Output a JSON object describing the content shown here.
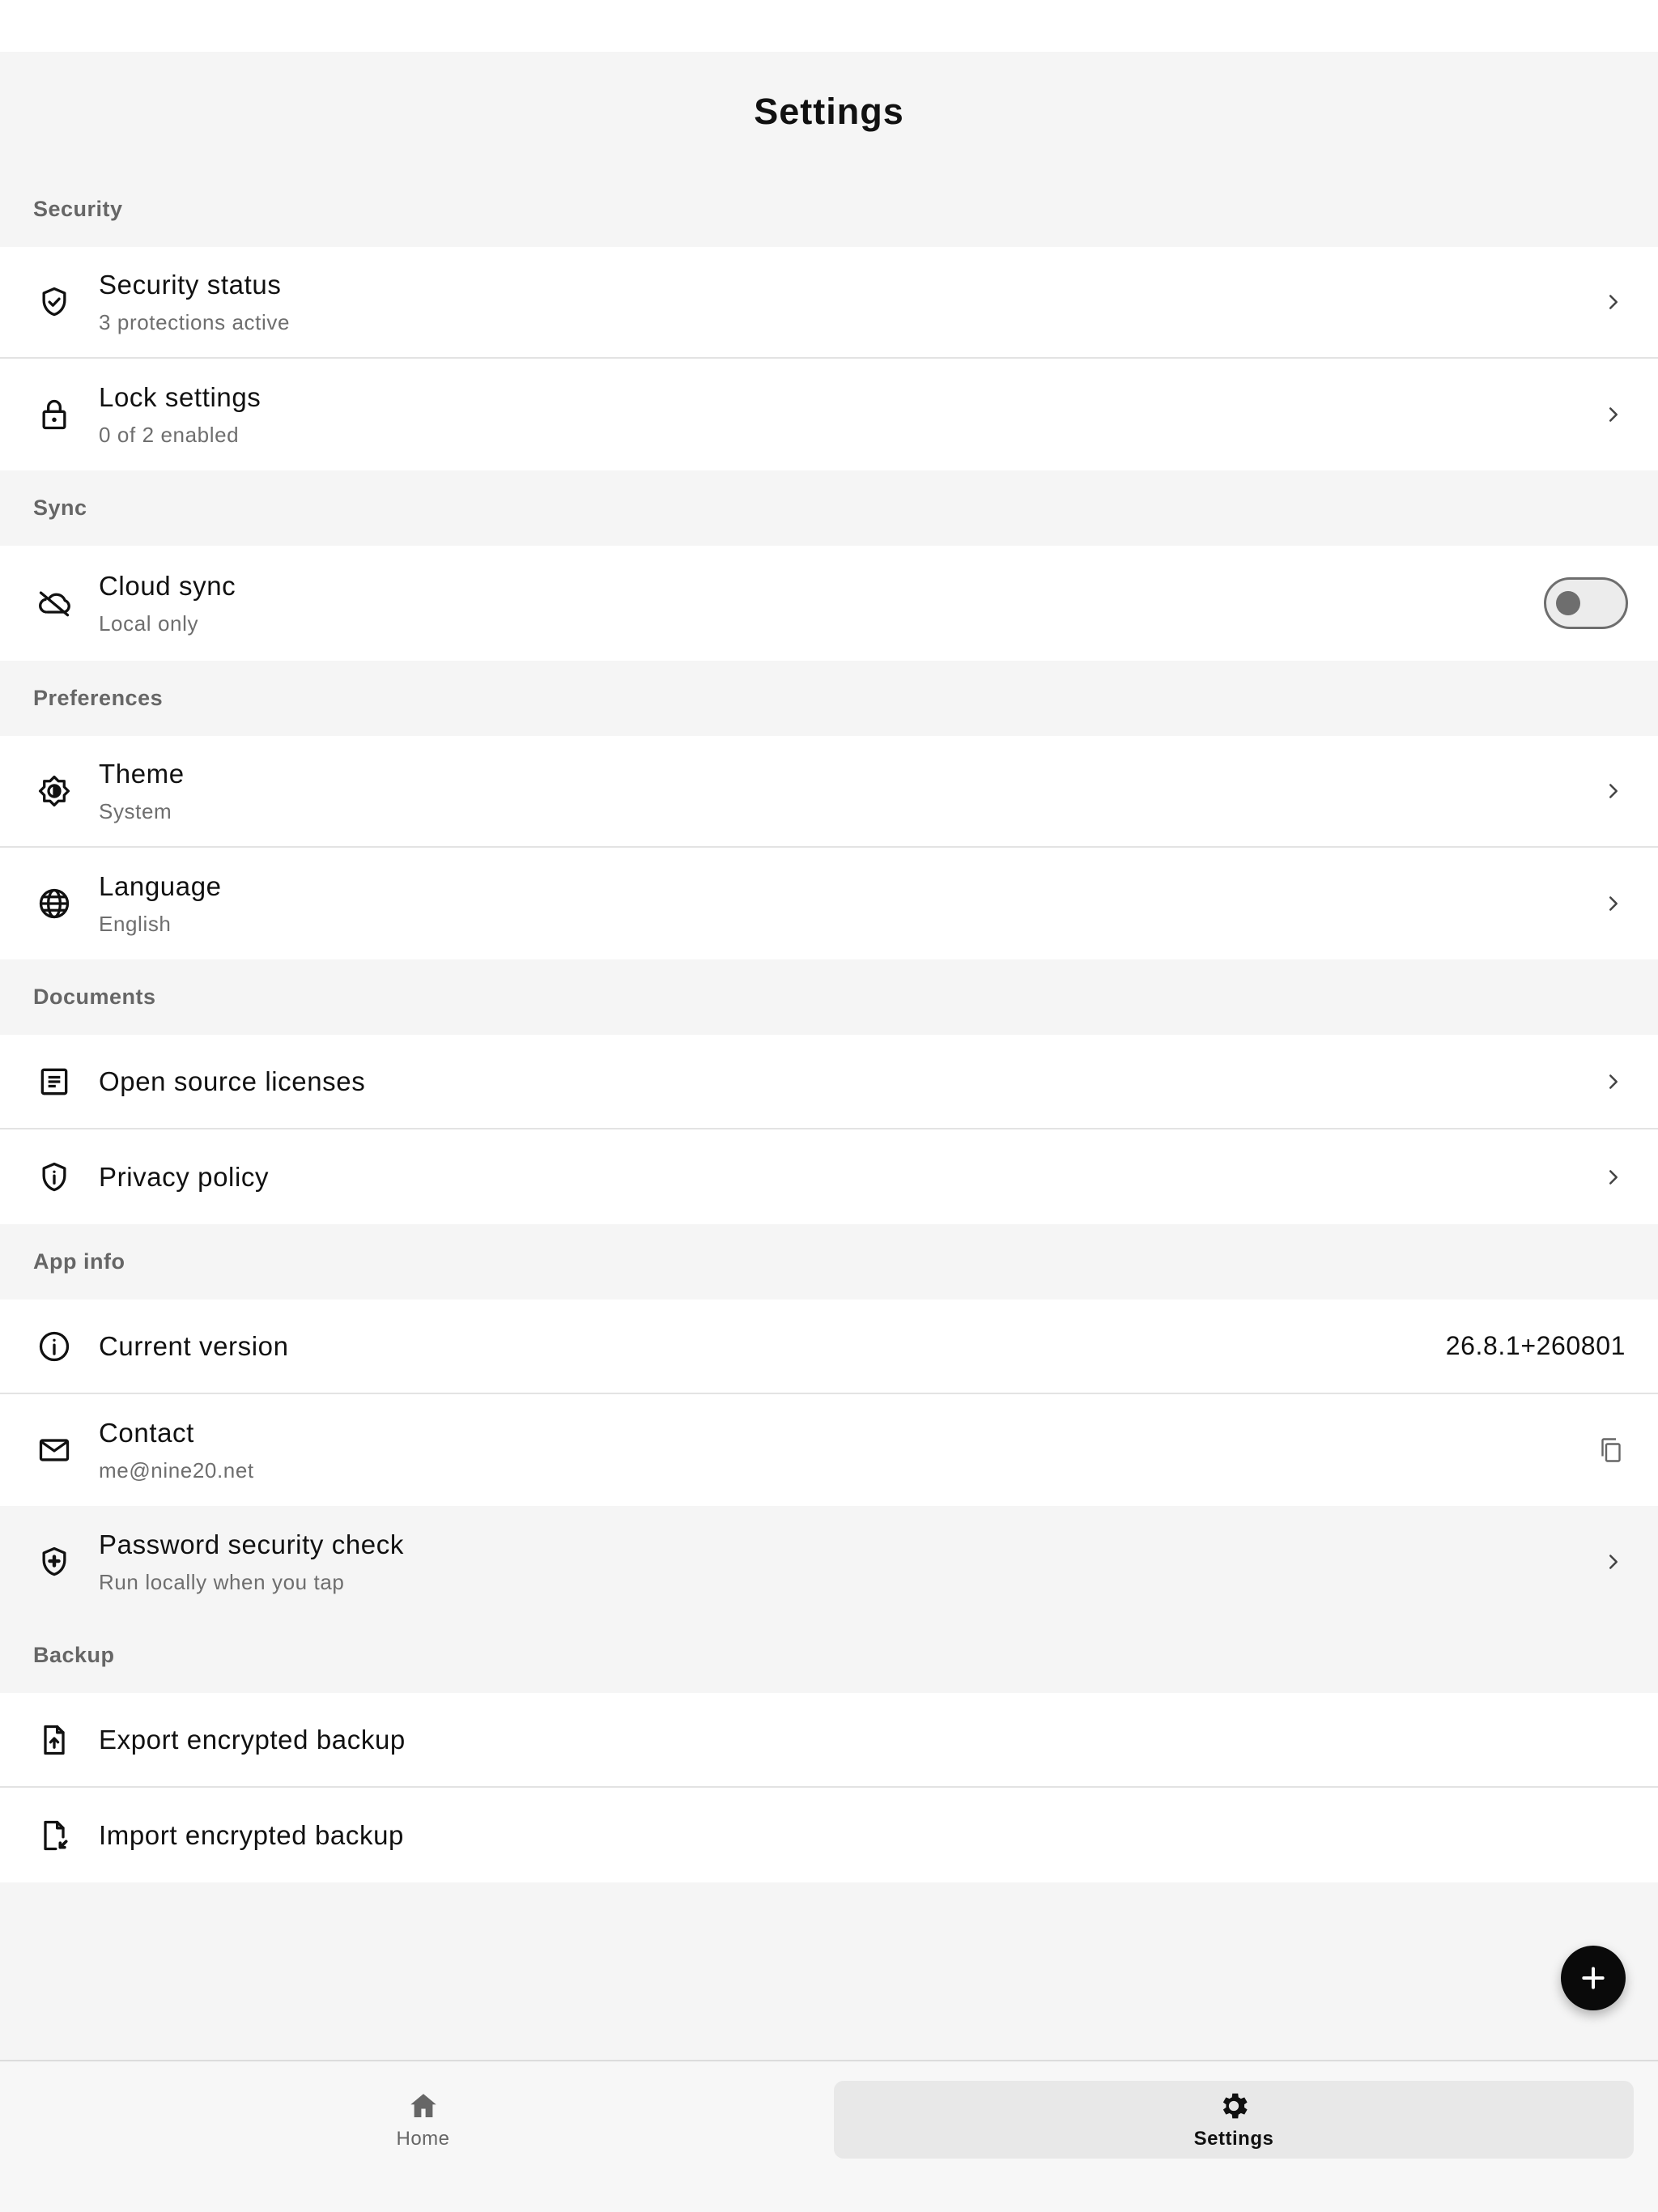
{
  "page": {
    "title": "Settings"
  },
  "sections": {
    "security": {
      "header": "Security",
      "security_status": {
        "title": "Security status",
        "subtitle": "3 protections active"
      },
      "lock_settings": {
        "title": "Lock settings",
        "subtitle": "0 of 2 enabled"
      }
    },
    "sync": {
      "header": "Sync",
      "cloud_sync": {
        "title": "Cloud sync",
        "subtitle": "Local only",
        "enabled": false
      }
    },
    "preferences": {
      "header": "Preferences",
      "theme": {
        "title": "Theme",
        "subtitle": "System"
      },
      "language": {
        "title": "Language",
        "subtitle": "English"
      }
    },
    "documents": {
      "header": "Documents",
      "licenses": {
        "title": "Open source licenses"
      },
      "privacy": {
        "title": "Privacy policy"
      }
    },
    "app_info": {
      "header": "App info",
      "version": {
        "title": "Current version",
        "value": "26.8.1+260801"
      },
      "contact": {
        "title": "Contact",
        "subtitle": "me@nine20.net"
      },
      "password_check": {
        "title": "Password security check",
        "subtitle": "Run locally when you tap"
      }
    },
    "backup": {
      "header": "Backup",
      "export": {
        "title": "Export encrypted backup"
      },
      "import": {
        "title": "Import encrypted backup"
      }
    }
  },
  "bottom_nav": {
    "home": {
      "label": "Home",
      "icon": "home-icon"
    },
    "settings": {
      "label": "Settings",
      "icon": "gear-icon",
      "selected": true
    }
  },
  "fab": {
    "icon": "plus-icon"
  },
  "colors": {
    "accent": "#0a0a0a",
    "surface": "#ffffff",
    "background": "#f5f5f5",
    "muted_text": "#6e6e6e"
  }
}
